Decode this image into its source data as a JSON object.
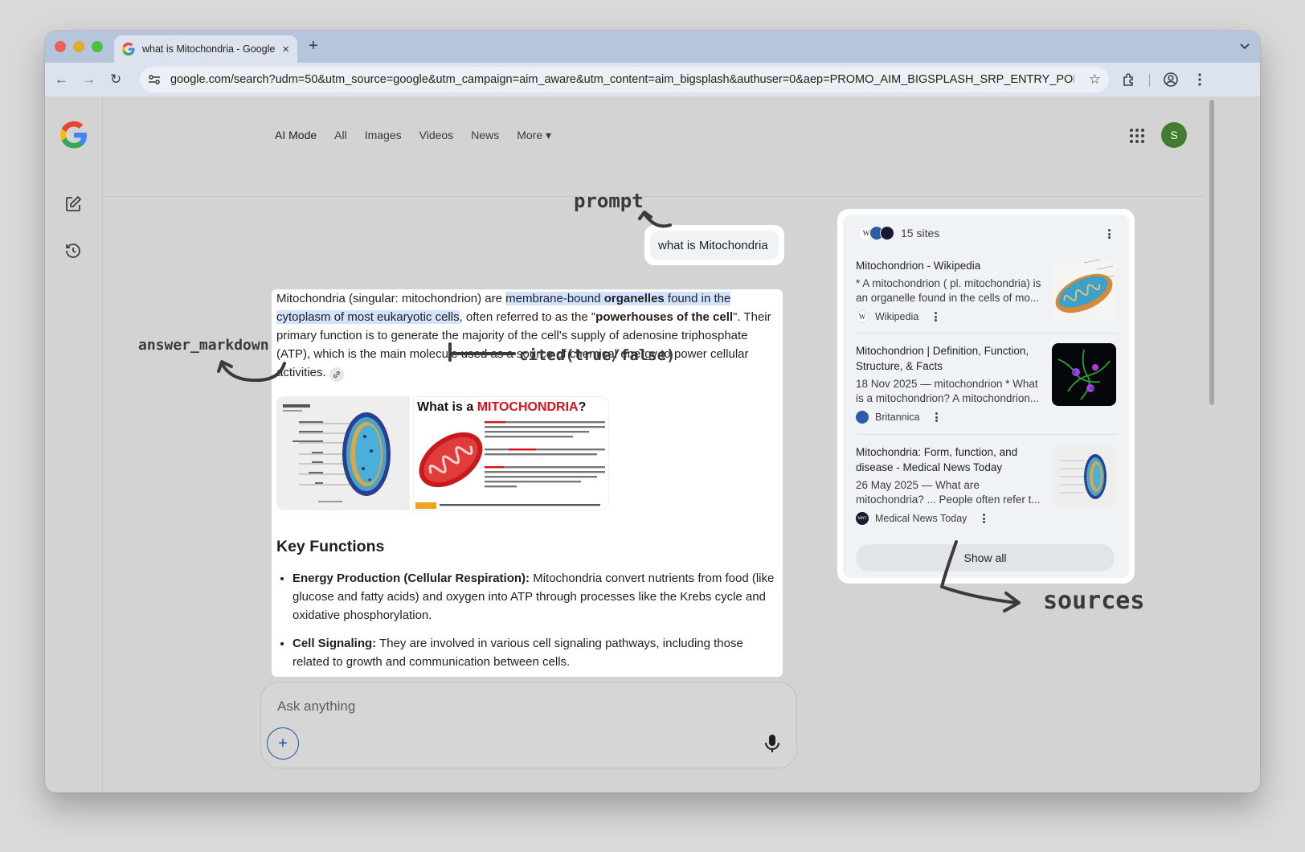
{
  "browser": {
    "tab_title": "what is Mitochondria - Google",
    "tab_close": "×",
    "new_tab": "+",
    "url": "google.com/search?udm=50&utm_source=google&utm_campaign=aim_aware&utm_content=aim_bigsplash&authuser=0&aep=PROMO_AIM_BIGSPLASH_SRP_ENTRY_POINT...",
    "back": "←",
    "forward": "→",
    "reload": "↻",
    "star": "☆"
  },
  "nav": {
    "tabs": [
      "AI Mode",
      "All",
      "Images",
      "Videos",
      "News",
      "More ▾"
    ],
    "avatar_letter": "S"
  },
  "prompt": {
    "text": "what is Mitochondria"
  },
  "answer": {
    "p1_a": "Mitochondria (singular: mitochondrion) are ",
    "p1_hl_a": "membrane-bound ",
    "p1_hl_b": "organelles",
    "p1_hl_c": " found in the cytoplasm of most eukaryotic cells",
    "p1_b": ", often referred to as the \"",
    "p1_bold": "powerhouses of the cell",
    "p1_c": "\". Their primary function is to generate the majority of the cell's supply of adenosine triphosphate (ATP), which is the main molecule used as a source of chemical energy to power cellular activities.",
    "image2_title_a": "What is a ",
    "image2_title_b": "MITOCHONDRIA",
    "image2_title_c": "?",
    "key_functions_title": "Key Functions",
    "bullets": [
      {
        "bold": "Energy Production (Cellular Respiration):",
        "text": " Mitochondria convert nutrients from food (like glucose and fatty acids) and oxygen into ATP through processes like the Krebs cycle and oxidative phosphorylation."
      },
      {
        "bold": "Cell Signaling:",
        "text": " They are involved in various cell signaling pathways, including those related to growth and communication between cells."
      }
    ]
  },
  "ask": {
    "placeholder": "Ask anything",
    "plus": "+"
  },
  "sources": {
    "count_label": "15 sites",
    "items": [
      {
        "title": "Mitochondrion - Wikipedia",
        "snippet": "* A mitochondrion ( pl. mitochondria) is an organelle found in the cells of mo...",
        "site": "Wikipedia",
        "fav": "W"
      },
      {
        "title": "Mitochondrion | Definition, Function, Structure, & Facts",
        "snippet": "18 Nov 2025 — mitochondrion * What is a mitochondrion? A mitochondrion...",
        "site": "Britannica",
        "fav": "B"
      },
      {
        "title": "Mitochondria: Form, function, and disease - Medical News Today",
        "snippet": "26 May 2025 — What are mitochondria? ... People often refer t...",
        "site": "Medical News Today",
        "fav": "MNT"
      }
    ],
    "show_all": "Show all"
  },
  "annotations": {
    "prompt": "prompt",
    "answer": "answer_markdown",
    "cited": "cited(true/false)",
    "sources": "sources"
  },
  "colors": {
    "highlight": "#d3e3fd",
    "avatar": "#3f7e2e",
    "accent_blue": "#1b4fb5"
  }
}
